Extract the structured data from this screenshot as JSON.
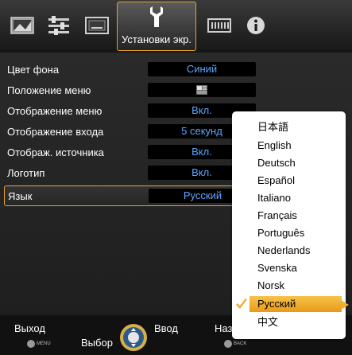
{
  "tabs": {
    "active_label": "Установки экр.",
    "icons": [
      "picture-icon",
      "adjust-sliders-icon",
      "screen-icon",
      "setup-wrench-icon",
      "signal-icon",
      "info-icon"
    ]
  },
  "settings": [
    {
      "name": "Цвет фона",
      "value": "Синий"
    },
    {
      "name": "Положение меню",
      "value": ""
    },
    {
      "name": "Отображение меню",
      "value": "Вкл."
    },
    {
      "name": "Отображение входа",
      "value": "5 секунд"
    },
    {
      "name": "Отображ. источника",
      "value": "Вкл."
    },
    {
      "name": "Логотип",
      "value": "Вкл."
    },
    {
      "name": "Язык",
      "value": "Русский"
    }
  ],
  "languages": {
    "options": [
      "日本語",
      "English",
      "Deutsch",
      "Español",
      "Italiano",
      "Français",
      "Português",
      "Nederlands",
      "Svenska",
      "Norsk",
      "Русский",
      "中文"
    ],
    "selected": "Русский"
  },
  "hints": {
    "exit": "Выход",
    "exit_button": "MENU",
    "select": "Выбор",
    "enter": "Ввод",
    "back_partial": "Наз",
    "back_button": "BACK"
  },
  "colors": {
    "accent": "#e8a032",
    "value_text": "#5aa7ff",
    "selection": "#f0ad30"
  }
}
